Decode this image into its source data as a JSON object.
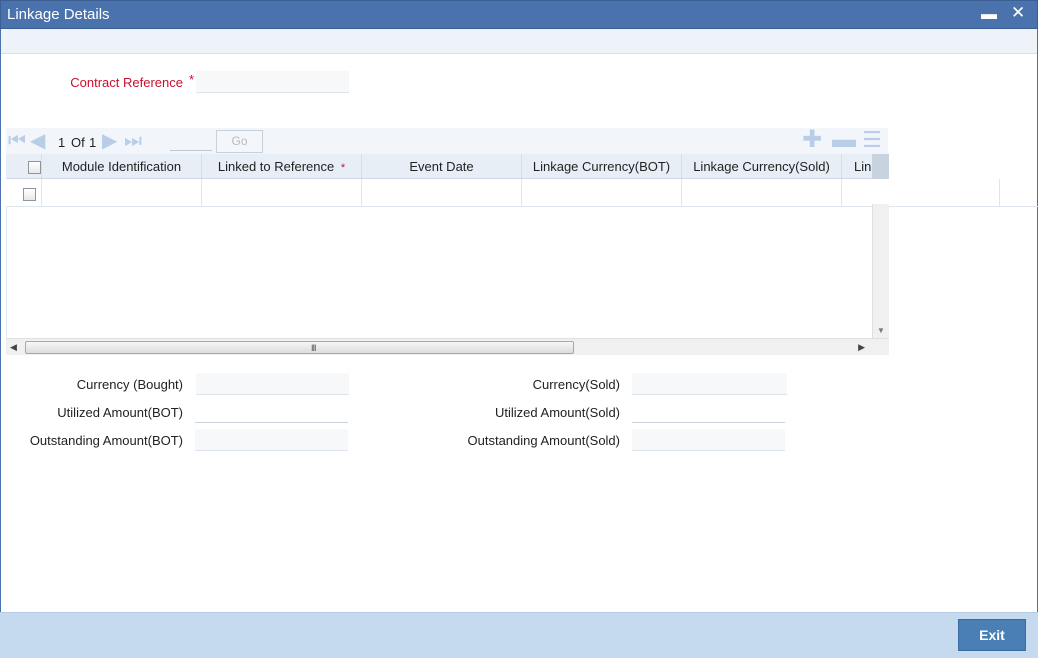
{
  "window": {
    "title": "Linkage Details",
    "minimize_glyph": "▬",
    "close_glyph": "✕"
  },
  "form": {
    "contract_reference_label": "Contract Reference",
    "required_mark": "*"
  },
  "grid": {
    "pager": {
      "current": "1",
      "of_label": "Of",
      "total": "1",
      "go_label": "Go"
    },
    "columns": [
      {
        "label": "Module Identification"
      },
      {
        "label": "Linked to Reference",
        "required": "*"
      },
      {
        "label": "Event Date"
      },
      {
        "label": "Linkage Currency(BOT)"
      },
      {
        "label": "Linkage Currency(Sold)"
      },
      {
        "label": "Lin"
      }
    ],
    "scroll_grip": "III"
  },
  "details": {
    "currency_bought_label": "Currency (Bought)",
    "utilized_amount_bot_label": "Utilized Amount(BOT)",
    "outstanding_amount_bot_label": "Outstanding Amount(BOT)",
    "currency_sold_label": "Currency(Sold)",
    "utilized_amount_sold_label": "Utilized Amount(Sold)",
    "outstanding_amount_sold_label": "Outstanding Amount(Sold)"
  },
  "footer": {
    "exit_label": "Exit"
  },
  "icons": {
    "first": "first-page-icon",
    "prev": "previous-page-icon",
    "next": "next-page-icon",
    "last": "last-page-icon",
    "add": "add-row-icon",
    "delete": "delete-row-icon",
    "view": "single-view-icon"
  },
  "colors": {
    "title_bar": "#4a72ac",
    "required": "#c8102e",
    "footer": "#c5daee",
    "exit_button": "#4a7fb6"
  }
}
